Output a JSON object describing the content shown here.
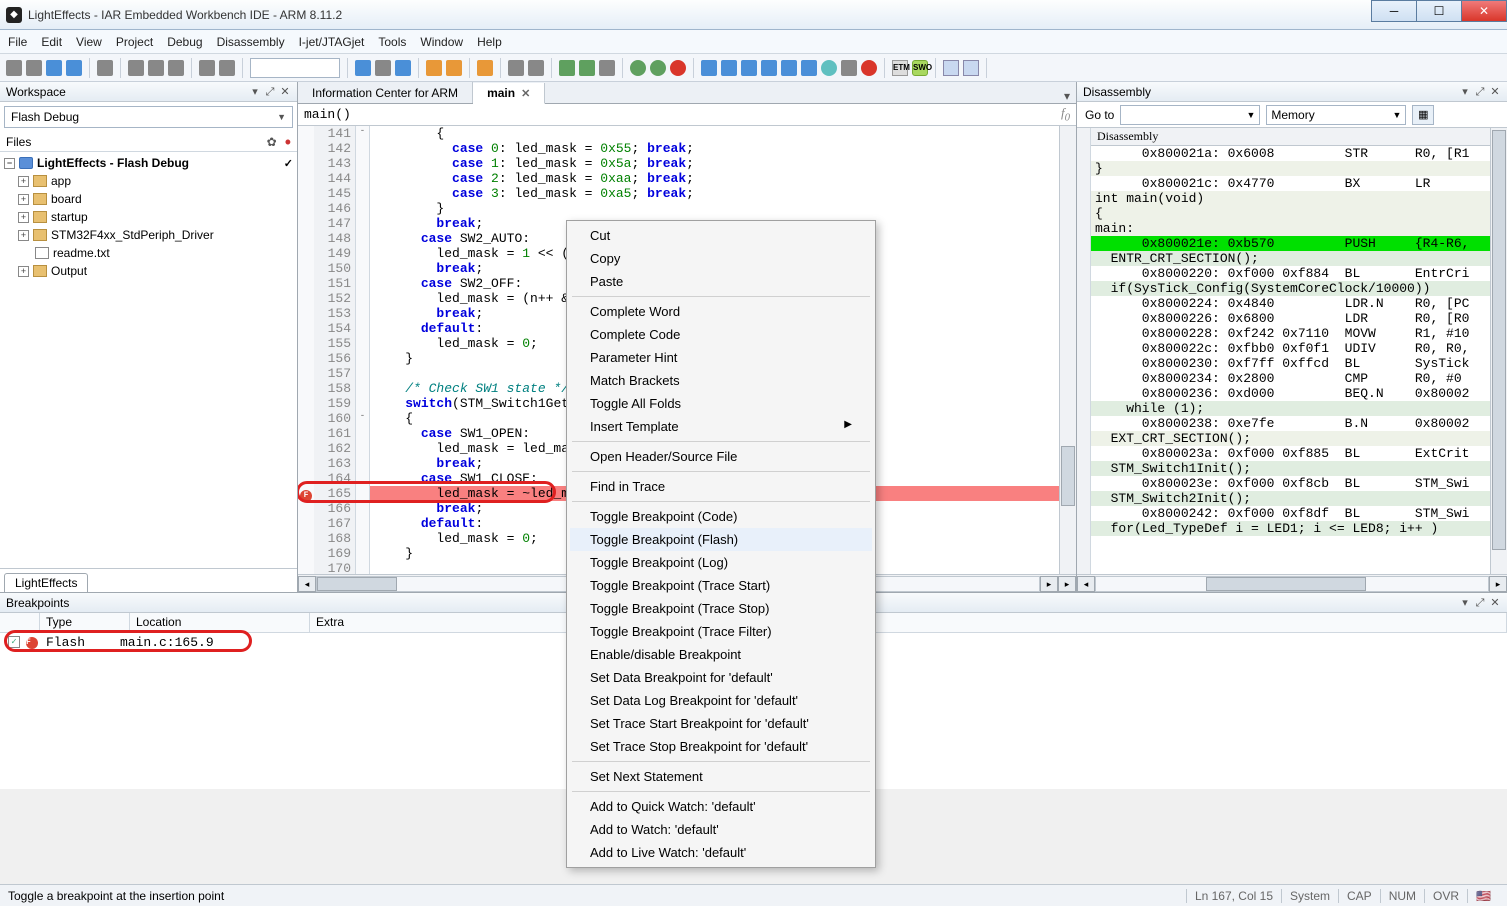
{
  "app": {
    "title": "LightEffects - IAR Embedded Workbench IDE - ARM 8.11.2"
  },
  "menubar": [
    "File",
    "Edit",
    "View",
    "Project",
    "Debug",
    "Disassembly",
    "I-jet/JTAGjet",
    "Tools",
    "Window",
    "Help"
  ],
  "workspace": {
    "title": "Workspace",
    "config": "Flash Debug",
    "files_label": "Files",
    "project_root": "LightEffects - Flash Debug",
    "nodes": [
      {
        "label": "app",
        "type": "folder"
      },
      {
        "label": "board",
        "type": "folder"
      },
      {
        "label": "startup",
        "type": "folder"
      },
      {
        "label": "STM32F4xx_StdPeriph_Driver",
        "type": "folder"
      },
      {
        "label": "readme.txt",
        "type": "file"
      },
      {
        "label": "Output",
        "type": "folder"
      }
    ],
    "tab": "LightEffects"
  },
  "editor": {
    "tab_info": "Information Center for ARM",
    "tab_main": "main",
    "func": "main()",
    "lines": [
      {
        "n": 141,
        "fold": "-",
        "t": "        {"
      },
      {
        "n": 142,
        "t": "          case 0: led_mask = 0x55; break;"
      },
      {
        "n": 143,
        "t": "          case 1: led_mask = 0x5a; break;"
      },
      {
        "n": 144,
        "t": "          case 2: led_mask = 0xaa; break;"
      },
      {
        "n": 145,
        "t": "          case 3: led_mask = 0xa5; break;"
      },
      {
        "n": 146,
        "t": "        }"
      },
      {
        "n": 147,
        "t": "        break;"
      },
      {
        "n": 148,
        "t": "      case SW2_AUTO:"
      },
      {
        "n": 149,
        "t": "        led_mask = 1 << (n++ %"
      },
      {
        "n": 150,
        "t": "        break;"
      },
      {
        "n": 151,
        "t": "      case SW2_OFF:"
      },
      {
        "n": 152,
        "t": "        led_mask = (n++ & 2)?1"
      },
      {
        "n": 153,
        "t": "        break;"
      },
      {
        "n": 154,
        "t": "      default:"
      },
      {
        "n": 155,
        "t": "        led_mask = 0;"
      },
      {
        "n": 156,
        "t": "    }"
      },
      {
        "n": 157,
        "t": ""
      },
      {
        "n": 158,
        "t": "    /* Check SW1 state */",
        "cmt": true
      },
      {
        "n": 159,
        "t": "    switch(STM_Switch1GetState"
      },
      {
        "n": 160,
        "fold": "-",
        "t": "    {"
      },
      {
        "n": 161,
        "t": "      case SW1_OPEN:"
      },
      {
        "n": 162,
        "t": "        led_mask = led_mask;"
      },
      {
        "n": 163,
        "t": "        break;"
      },
      {
        "n": 164,
        "t": "      case SW1_CLOSE:"
      },
      {
        "n": 165,
        "bp": true,
        "t": "        led_mask = ~led_mask;"
      },
      {
        "n": 166,
        "t": "        break;"
      },
      {
        "n": 167,
        "t": "      default:"
      },
      {
        "n": 168,
        "t": "        led_mask = 0;"
      },
      {
        "n": 169,
        "t": "    }"
      },
      {
        "n": 170,
        "t": ""
      }
    ]
  },
  "disasm": {
    "title": "Disassembly",
    "goto_label": "Go to",
    "view_label": "Memory",
    "header": "Disassembly",
    "lines": [
      {
        "c": "",
        "t": "      0x800021a: 0x6008         STR      R0, [R1"
      },
      {
        "c": "sh",
        "t": "}"
      },
      {
        "c": "",
        "t": "      0x800021c: 0x4770         BX       LR"
      },
      {
        "c": "sh",
        "t": "int main(void)"
      },
      {
        "c": "sh",
        "t": "{"
      },
      {
        "c": "sh",
        "t": "main:"
      },
      {
        "c": "hl",
        "t": "      0x800021e: 0xb570         PUSH     {R4-R6,"
      },
      {
        "c": "shg",
        "t": "  ENTR_CRT_SECTION();"
      },
      {
        "c": "",
        "t": "      0x8000220: 0xf000 0xf884  BL       EntrCri"
      },
      {
        "c": "shg",
        "t": "  if(SysTick_Config(SystemCoreClock/10000))"
      },
      {
        "c": "",
        "t": "      0x8000224: 0x4840         LDR.N    R0, [PC"
      },
      {
        "c": "",
        "t": "      0x8000226: 0x6800         LDR      R0, [R0"
      },
      {
        "c": "",
        "t": "      0x8000228: 0xf242 0x7110  MOVW     R1, #10"
      },
      {
        "c": "",
        "t": "      0x800022c: 0xfbb0 0xf0f1  UDIV     R0, R0,"
      },
      {
        "c": "",
        "t": "      0x8000230: 0xf7ff 0xffcd  BL       SysTick"
      },
      {
        "c": "",
        "t": "      0x8000234: 0x2800         CMP      R0, #0"
      },
      {
        "c": "",
        "t": "      0x8000236: 0xd000         BEQ.N    0x80002"
      },
      {
        "c": "shg",
        "t": "    while (1);"
      },
      {
        "c": "",
        "t": "      0x8000238: 0xe7fe         B.N      0x80002"
      },
      {
        "c": "sh",
        "t": "  EXT_CRT_SECTION();"
      },
      {
        "c": "",
        "t": "      0x800023a: 0xf000 0xf885  BL       ExtCrit"
      },
      {
        "c": "shg",
        "t": "  STM_Switch1Init();"
      },
      {
        "c": "",
        "t": "      0x800023e: 0xf000 0xf8cb  BL       STM_Swi"
      },
      {
        "c": "shg",
        "t": "  STM_Switch2Init();"
      },
      {
        "c": "",
        "t": "      0x8000242: 0xf000 0xf8df  BL       STM_Swi"
      },
      {
        "c": "shg",
        "t": "  for(Led_TypeDef i = LED1; i <= LED8; i++ )"
      }
    ]
  },
  "context_menu": {
    "items": [
      {
        "label": "Cut"
      },
      {
        "label": "Copy"
      },
      {
        "label": "Paste"
      },
      {
        "sep": true
      },
      {
        "label": "Complete Word"
      },
      {
        "label": "Complete Code"
      },
      {
        "label": "Parameter Hint"
      },
      {
        "label": "Match Brackets"
      },
      {
        "label": "Toggle All Folds"
      },
      {
        "label": "Insert Template",
        "sub": true
      },
      {
        "sep": true
      },
      {
        "label": "Open Header/Source File"
      },
      {
        "sep": true
      },
      {
        "label": "Find in Trace"
      },
      {
        "sep": true
      },
      {
        "label": "Toggle Breakpoint (Code)"
      },
      {
        "label": "Toggle Breakpoint (Flash)",
        "hilite": true
      },
      {
        "label": "Toggle Breakpoint (Log)"
      },
      {
        "label": "Toggle Breakpoint (Trace Start)"
      },
      {
        "label": "Toggle Breakpoint (Trace Stop)"
      },
      {
        "label": "Toggle Breakpoint (Trace Filter)"
      },
      {
        "label": "Enable/disable Breakpoint"
      },
      {
        "label": "Set Data Breakpoint for 'default'"
      },
      {
        "label": "Set Data Log Breakpoint for 'default'"
      },
      {
        "label": "Set Trace Start Breakpoint for 'default'"
      },
      {
        "label": "Set Trace Stop Breakpoint for 'default'"
      },
      {
        "sep": true
      },
      {
        "label": "Set Next Statement"
      },
      {
        "sep": true
      },
      {
        "label": "Add to Quick Watch:  'default'"
      },
      {
        "label": "Add to Watch: 'default'"
      },
      {
        "label": "Add to Live Watch: 'default'"
      }
    ]
  },
  "breakpoints": {
    "title": "Breakpoints",
    "cols": {
      "type": "Type",
      "location": "Location",
      "extra": "Extra"
    },
    "rows": [
      {
        "enabled": true,
        "type": "Flash",
        "location": "main.c:165.9"
      }
    ]
  },
  "status": {
    "hint": "Toggle a breakpoint at the insertion point",
    "pos": "Ln 167, Col 15",
    "mode": "System",
    "cap": "CAP",
    "num": "NUM",
    "ovr": "OVR"
  }
}
